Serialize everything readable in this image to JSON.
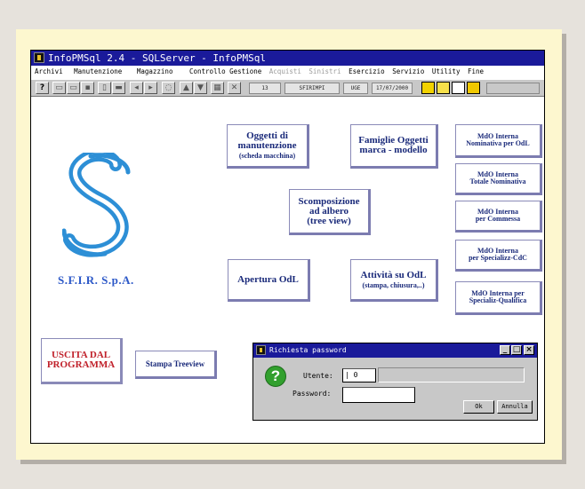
{
  "window": {
    "title": "InfoPMSql 2.4 - SQLServer - InfoPMSql",
    "menu": [
      {
        "label": "Archivi",
        "enabled": true
      },
      {
        "label": "Manutenzione",
        "enabled": true
      },
      {
        "label": "Magazzino",
        "enabled": true
      },
      {
        "label": "Controllo Gestione",
        "enabled": true
      },
      {
        "label": "Acquisti",
        "enabled": false
      },
      {
        "label": "Sinistri",
        "enabled": false
      },
      {
        "label": "Esercizio",
        "enabled": true
      },
      {
        "label": "Servizio",
        "enabled": true
      },
      {
        "label": "Utility",
        "enabled": true
      },
      {
        "label": "Fine",
        "enabled": true
      }
    ],
    "toolbar": {
      "help": "?",
      "field1": "13",
      "field2": "SFIRIMPI",
      "field3": "UGE",
      "field4": "17/07/2000"
    }
  },
  "company": {
    "name": "S.F.I.R. S.p.A.",
    "logo_color": "#2d8fd6"
  },
  "buttons": {
    "oggetti": {
      "line1": "Oggetti di",
      "line2": "manutenzione",
      "sub": "(scheda macchina)"
    },
    "famiglie": {
      "line1": "Famiglie Oggetti",
      "line2": "marca - modello"
    },
    "scomposizione": {
      "line1": "Scomposizione",
      "line2": "ad albero",
      "line3": "(tree view)"
    },
    "apertura": {
      "line1": "Apertura OdL"
    },
    "attivita": {
      "line1": "Attività su OdL",
      "sub": "(stampa, chiusura,..)"
    },
    "mdo1": {
      "line1": "MdO Interna",
      "line2": "Nominativa per OdL"
    },
    "mdo2": {
      "line1": "MdO Interna",
      "line2": "Totale Nominativa"
    },
    "mdo3": {
      "line1": "MdO Interna",
      "line2": "per Commessa"
    },
    "mdo4": {
      "line1": "MdO Interna",
      "line2": "per Specializz-CdC"
    },
    "mdo5": {
      "line1": "MdO Interna per",
      "line2": "Specializ-Qualifica"
    },
    "uscita": {
      "line1": "USCITA DAL",
      "line2": "PROGRAMMA"
    },
    "stampa": {
      "line1": "Stampa Treeview"
    }
  },
  "dialog": {
    "title": "Richiesta password",
    "utente_label": "Utente:",
    "utente_value": "| 0",
    "password_label": "Password:",
    "password_value": "",
    "ok": "Ok",
    "annulla": "Annulla",
    "icon": "question-icon"
  }
}
